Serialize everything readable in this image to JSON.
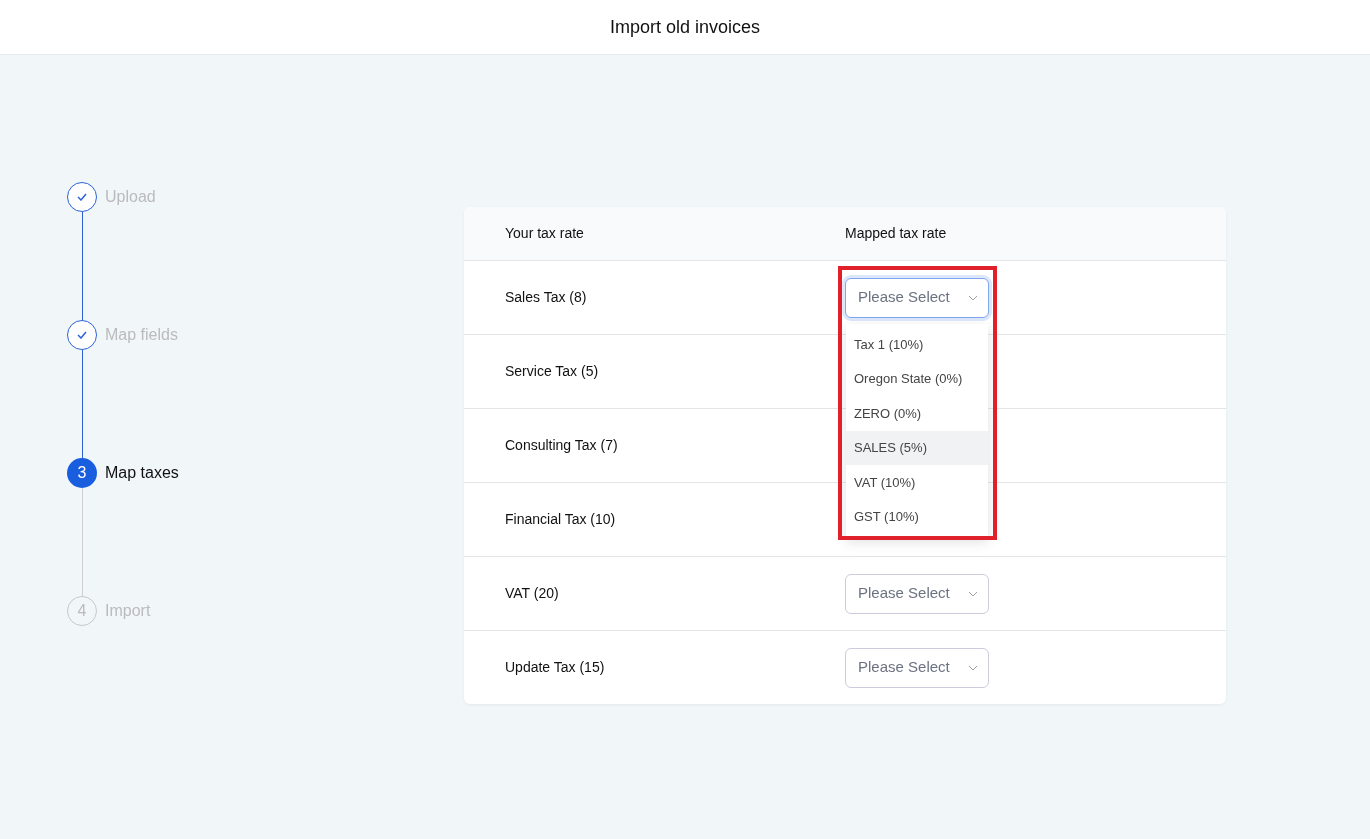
{
  "header": {
    "title": "Import old invoices"
  },
  "steps": [
    {
      "label": "Upload",
      "kind": "done"
    },
    {
      "label": "Map fields",
      "kind": "done"
    },
    {
      "number": "3",
      "label": "Map taxes",
      "kind": "current"
    },
    {
      "number": "4",
      "label": "Import",
      "kind": "todo"
    }
  ],
  "table": {
    "columns": [
      "Your tax rate",
      "Mapped tax rate"
    ],
    "rows": [
      {
        "label": "Sales Tax (8)",
        "select": {
          "placeholder": "Please Select",
          "open": true,
          "outlined": true,
          "options": [
            {
              "label": "Tax 1 (10%)",
              "highlighted": false
            },
            {
              "label": "Oregon State (0%)",
              "highlighted": false
            },
            {
              "label": "ZERO (0%)",
              "highlighted": false
            },
            {
              "label": "SALES (5%)",
              "highlighted": true
            },
            {
              "label": "VAT (10%)",
              "highlighted": false
            },
            {
              "label": "GST (10%)",
              "highlighted": false
            }
          ]
        }
      },
      {
        "label": "Service Tax (5)"
      },
      {
        "label": "Consulting Tax (7)"
      },
      {
        "label": "Financial Tax (10)"
      },
      {
        "label": "VAT (20)",
        "select": {
          "placeholder": "Please Select",
          "open": false
        }
      },
      {
        "label": "Update Tax (15)",
        "select": {
          "placeholder": "Please Select",
          "open": false
        }
      }
    ]
  }
}
